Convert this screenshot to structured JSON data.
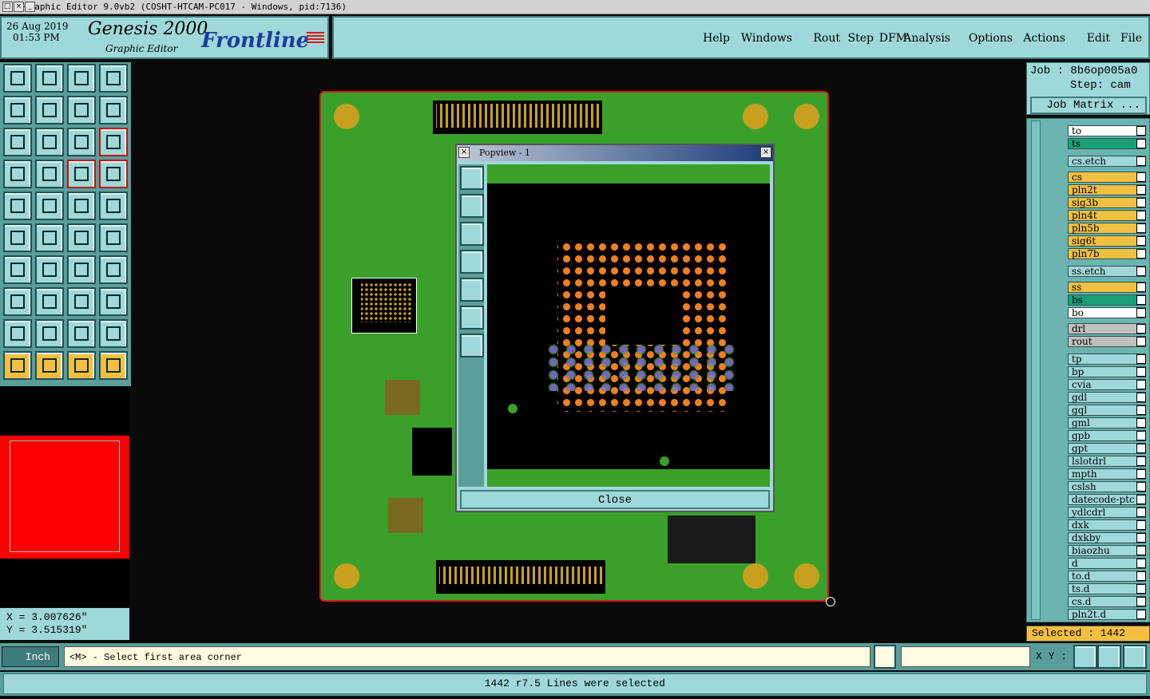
{
  "window": {
    "title": "Graphic Editor 9.0vb2 (COSHT-HTCAM-PC017 - Windows, pid:7136)"
  },
  "header": {
    "brand": "Frontline",
    "app_name": "Genesis 2000",
    "subtitle": "Graphic Editor",
    "date": "26 Aug 2019",
    "time": "01:53 PM"
  },
  "menu": [
    "File",
    "Edit",
    "Actions",
    "Options",
    "Analysis",
    "DFM",
    "Step",
    "Rout",
    "Windows",
    "Help"
  ],
  "job": {
    "job_label": "Job : 8b6op005a0",
    "step_label": "Step: cam",
    "matrix_button": "Job Matrix ..."
  },
  "layers": [
    {
      "name": "to",
      "style": "white"
    },
    {
      "name": "ts",
      "style": "green"
    },
    {
      "name": "cs.etch",
      "style": "teal"
    },
    {
      "name": "cs",
      "style": "gold"
    },
    {
      "name": "pln2t",
      "style": "gold"
    },
    {
      "name": "sig3b",
      "style": "gold"
    },
    {
      "name": "pln4t",
      "style": "gold"
    },
    {
      "name": "pln5b",
      "style": "gold"
    },
    {
      "name": "sig6t",
      "style": "gold"
    },
    {
      "name": "pln7b",
      "style": "gold"
    },
    {
      "name": "ss.etch",
      "style": "teal"
    },
    {
      "name": "ss",
      "style": "gold"
    },
    {
      "name": "bs",
      "style": "green"
    },
    {
      "name": "bo",
      "style": "white"
    },
    {
      "name": "drl",
      "style": "grey"
    },
    {
      "name": "rout",
      "style": "grey"
    },
    {
      "name": "tp",
      "style": "teal"
    },
    {
      "name": "bp",
      "style": "teal"
    },
    {
      "name": "cvia",
      "style": "teal"
    },
    {
      "name": "gdl",
      "style": "teal"
    },
    {
      "name": "gql",
      "style": "teal"
    },
    {
      "name": "gml",
      "style": "teal"
    },
    {
      "name": "gpb",
      "style": "teal"
    },
    {
      "name": "gpt",
      "style": "teal"
    },
    {
      "name": "lslotdrl",
      "style": "teal"
    },
    {
      "name": "mpth",
      "style": "teal"
    },
    {
      "name": "cslsh",
      "style": "teal"
    },
    {
      "name": "datecode-ptc",
      "style": "teal"
    },
    {
      "name": "ydlcdrl",
      "style": "teal"
    },
    {
      "name": "dxk",
      "style": "teal"
    },
    {
      "name": "dxkby",
      "style": "teal"
    },
    {
      "name": "biaozhu",
      "style": "teal"
    },
    {
      "name": "d",
      "style": "teal"
    },
    {
      "name": "to.d",
      "style": "teal"
    },
    {
      "name": "ts.d",
      "style": "teal"
    },
    {
      "name": "cs.d",
      "style": "teal"
    },
    {
      "name": "pln2t.d",
      "style": "teal"
    }
  ],
  "selected_label": "Selected : 1442",
  "coords": {
    "x": "X = 3.007626\"",
    "y": "Y = 3.515319\""
  },
  "units_button": "Inch",
  "command_prompt": "<M> - Select first area corner",
  "xy_label": "X Y :",
  "status_message": "1442 r7.5 Lines were selected",
  "popup": {
    "title": "Popview - 1",
    "close_label": "Close"
  },
  "colors": {
    "teal": "#9fd8d8",
    "gold": "#f2c040",
    "board": "#3aa02a",
    "pad": "#c8a020",
    "outline": "#d81818"
  }
}
